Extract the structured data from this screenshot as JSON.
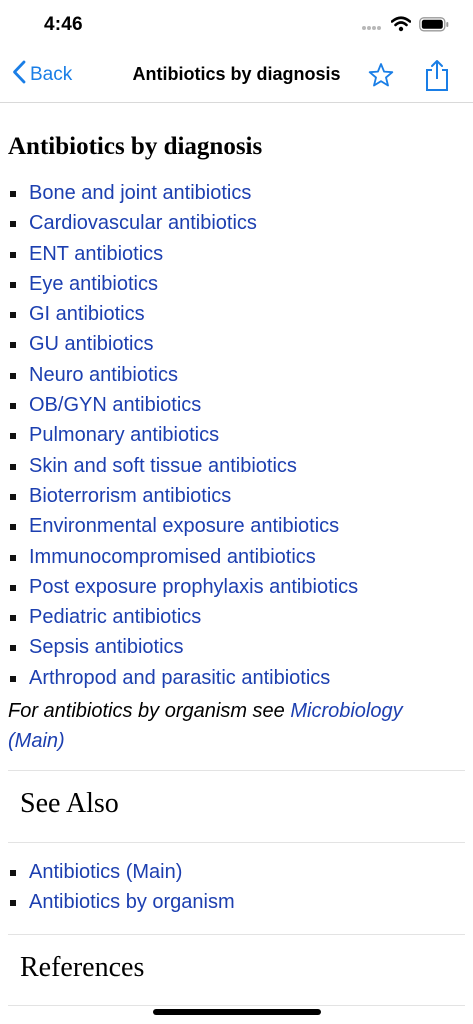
{
  "status_bar": {
    "time": "4:46",
    "icons": [
      "signal-dots-icon",
      "wifi-icon",
      "battery-icon"
    ]
  },
  "nav": {
    "back_label": "Back",
    "title": "Antibiotics by diagnosis",
    "icons": [
      "chevron-left-icon",
      "star-icon",
      "share-icon"
    ],
    "accent_color": "#1a7ee6"
  },
  "main": {
    "heading": "Antibiotics by diagnosis",
    "links": [
      "Bone and joint antibiotics",
      "Cardiovascular antibiotics",
      "ENT antibiotics",
      "Eye antibiotics",
      "GI antibiotics",
      "GU antibiotics",
      "Neuro antibiotics",
      "OB/GYN antibiotics",
      "Pulmonary antibiotics",
      "Skin and soft tissue antibiotics",
      "Bioterrorism antibiotics",
      "Environmental exposure antibiotics",
      "Immunocompromised antibiotics",
      "Post exposure prophylaxis antibiotics",
      "Pediatric antibiotics",
      "Sepsis antibiotics",
      "Arthropod and parasitic antibiotics"
    ],
    "note_text": "For antibiotics by organism see ",
    "note_link": "Microbiology (Main)",
    "link_color": "#1c3fb0"
  },
  "see_also": {
    "heading": "See Also",
    "links": [
      "Antibiotics (Main)",
      "Antibiotics by organism"
    ]
  },
  "references": {
    "heading": "References"
  }
}
